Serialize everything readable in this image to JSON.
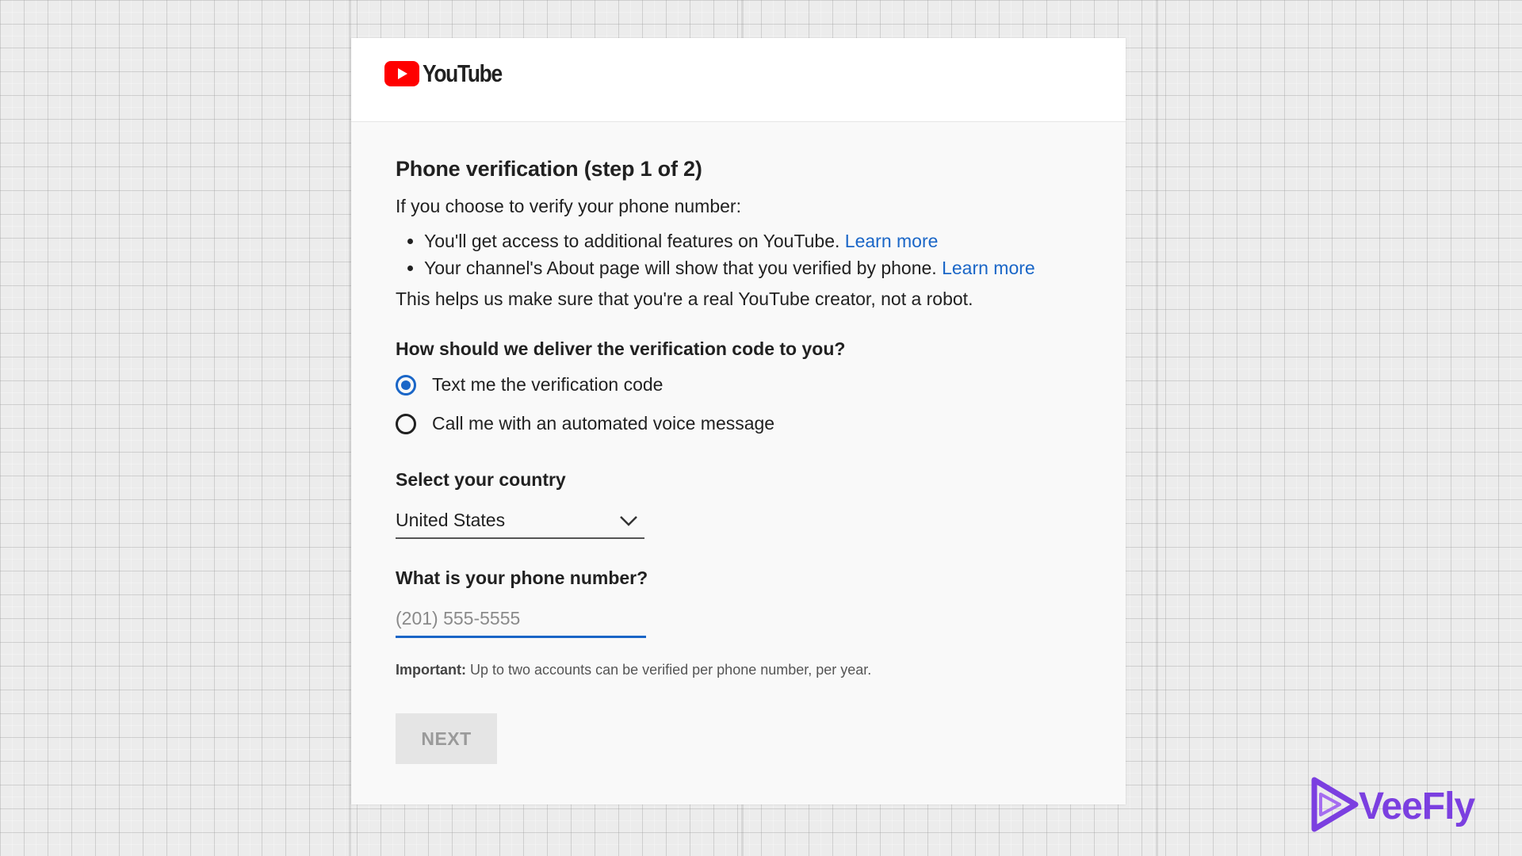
{
  "brand": {
    "logo_text": "YouTube"
  },
  "form": {
    "title": "Phone verification (step 1 of 2)",
    "intro": "If you choose to verify your phone number:",
    "bullets": [
      {
        "text": "You'll get access to additional features on YouTube. ",
        "link": "Learn more"
      },
      {
        "text": "Your channel's About page will show that you verified by phone. ",
        "link": "Learn more"
      }
    ],
    "outro": "This helps us make sure that you're a real YouTube creator, not a robot.",
    "delivery_question": "How should we deliver the verification code to you?",
    "delivery_options": [
      {
        "label": "Text me the verification code",
        "selected": true
      },
      {
        "label": "Call me with an automated voice message",
        "selected": false
      }
    ],
    "country_label": "Select your country",
    "country_value": "United States",
    "phone_label": "What is your phone number?",
    "phone_placeholder": "(201) 555-5555",
    "phone_value": "",
    "important_label": "Important:",
    "important_text": " Up to two accounts can be verified per phone number, per year.",
    "next_label": "NEXT"
  },
  "watermark": {
    "text": "VeeFly"
  },
  "colors": {
    "accent": "#1a66c7",
    "youtube_red": "#ff0000",
    "veefly_purple": "#7b3fe0",
    "button_disabled_bg": "#e5e5e5"
  },
  "icons": {
    "logo": "youtube-play-icon",
    "select": "chevron-down-icon",
    "watermark": "veefly-play-icon"
  }
}
